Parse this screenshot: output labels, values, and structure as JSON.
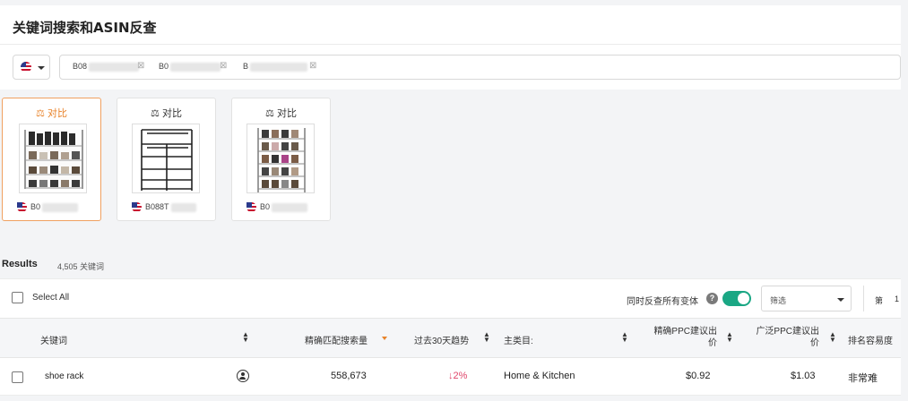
{
  "header": {
    "title": "关键词搜索和ASIN反查"
  },
  "search": {
    "country_icon": "us-flag-icon",
    "asin_tags": [
      "B08",
      "B0",
      "B"
    ]
  },
  "products": [
    {
      "compare_label": "对比",
      "asin": "B0",
      "active": true
    },
    {
      "compare_label": "对比",
      "asin": "B088T",
      "active": false
    },
    {
      "compare_label": "对比",
      "asin": "B0",
      "active": false
    }
  ],
  "results": {
    "label": "Results",
    "count": "4,505 关键词"
  },
  "toolbar": {
    "select_all": "Select All",
    "include_variants": "同时反查所有变体",
    "help": "?",
    "toggle_on": true,
    "filter_placeholder": "筛选",
    "page_prefix": "第",
    "page_number": "1"
  },
  "table": {
    "columns": [
      "关键词",
      "精确匹配搜索量",
      "过去30天趋势",
      "主类目:",
      "精确PPC建议出价",
      "广泛PPC建议出价",
      "排名容易度"
    ],
    "rows": [
      {
        "keyword": "shoe rack",
        "search_volume": "558,673",
        "trend": "↓2%",
        "category": "Home & Kitchen",
        "exact_ppc": "$0.92",
        "broad_ppc": "$1.03",
        "difficulty": "非常难"
      }
    ]
  },
  "colors": {
    "accent_orange": "#e8832a",
    "toggle_green": "#1aa784",
    "trend_down": "#e0466b"
  }
}
